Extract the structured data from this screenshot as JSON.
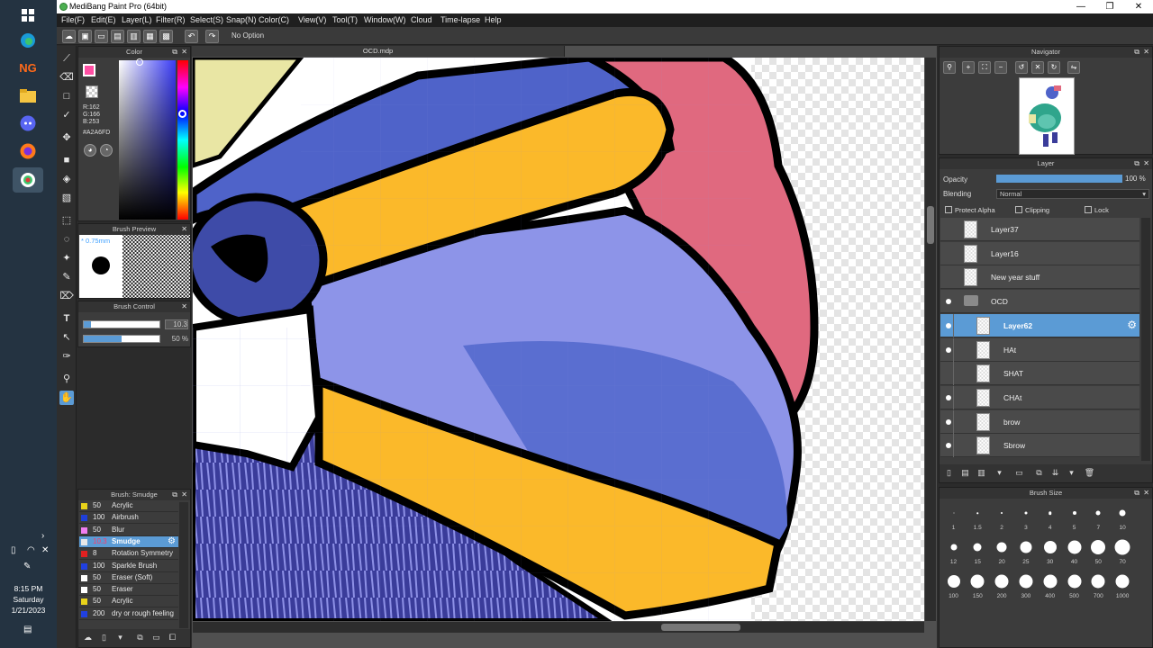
{
  "window": {
    "title": "MediBang Paint Pro (64bit)",
    "minimize": "—",
    "maximize": "❐",
    "close": "✕"
  },
  "menu": [
    "File(F)",
    "Edit(E)",
    "Layer(L)",
    "Filter(R)",
    "Select(S)",
    "Snap(N)",
    "Color(C)",
    "View(V)",
    "Tool(T)",
    "Window(W)",
    "Cloud",
    "Time-lapse",
    "Help"
  ],
  "toolbar": {
    "option_text": "No Option",
    "undo_icon": "↶",
    "redo_icon": "↷"
  },
  "taskbar": {
    "clock_time": "8:15 PM",
    "clock_day": "Saturday",
    "clock_date": "1/21/2023",
    "ng_label": "NG"
  },
  "color_panel": {
    "title": "Color",
    "r": "R:162",
    "g": "G:166",
    "b": "B:253",
    "hex": "#A2A6FD",
    "fg_color": "#ff4fa3"
  },
  "brush_preview": {
    "title": "Brush Preview",
    "size": "* 0.75mm"
  },
  "brush_control": {
    "title": "Brush Control",
    "size_value": "10.3",
    "size_fill": 0.1,
    "opacity_value": "50 %",
    "opacity_fill": 0.5
  },
  "brush_list": {
    "title": "Brush: Smudge",
    "items": [
      {
        "num": "50",
        "name": "Acrylic",
        "color": "#e8d21a"
      },
      {
        "num": "100",
        "name": "Airbrush",
        "color": "#1f3fd8"
      },
      {
        "num": "50",
        "name": "Blur",
        "color": "#f07ef0"
      },
      {
        "num": "10.3",
        "name": "Smudge",
        "color": "#e8e8e8",
        "active": true
      },
      {
        "num": "8",
        "name": "Rotation Symmetry",
        "color": "#e02020"
      },
      {
        "num": "100",
        "name": "Sparkle Brush",
        "color": "#2040e0"
      },
      {
        "num": "50",
        "name": "Eraser (Soft)",
        "color": "#ffffff"
      },
      {
        "num": "50",
        "name": "Eraser",
        "color": "#ffffff"
      },
      {
        "num": "50",
        "name": "Acrylic",
        "color": "#e8d21a"
      },
      {
        "num": "200",
        "name": "dry or rough feeling",
        "color": "#2040e0"
      }
    ]
  },
  "document": {
    "tab": "OCD.mdp"
  },
  "navigator": {
    "title": "Navigator"
  },
  "layer_panel": {
    "title": "Layer",
    "opacity_label": "Opacity",
    "opacity_value": "100 %",
    "blending_label": "Blending",
    "blending_value": "Normal",
    "protect_alpha": "Protect Alpha",
    "clipping": "Clipping",
    "lock": "Lock",
    "layers": [
      {
        "name": "Layer37",
        "visible": false,
        "indent": 0
      },
      {
        "name": "Layer16",
        "visible": false,
        "indent": 0
      },
      {
        "name": "New year stuff",
        "visible": false,
        "indent": 0
      },
      {
        "name": "OCD",
        "visible": true,
        "indent": 0,
        "folder": true
      },
      {
        "name": "Layer62",
        "visible": true,
        "indent": 1,
        "active": true
      },
      {
        "name": "HAt",
        "visible": true,
        "indent": 1
      },
      {
        "name": "SHAT",
        "visible": false,
        "indent": 1
      },
      {
        "name": "CHAt",
        "visible": true,
        "indent": 1
      },
      {
        "name": "brow",
        "visible": true,
        "indent": 1
      },
      {
        "name": "Sbrow",
        "visible": true,
        "indent": 1
      }
    ]
  },
  "brush_size_panel": {
    "title": "Brush Size",
    "sizes": [
      "1",
      "1.5",
      "2",
      "3",
      "4",
      "5",
      "7",
      "10",
      "12",
      "15",
      "20",
      "25",
      "30",
      "40",
      "50",
      "70",
      "100",
      "150",
      "200",
      "300",
      "400",
      "500",
      "700",
      "1000"
    ]
  }
}
